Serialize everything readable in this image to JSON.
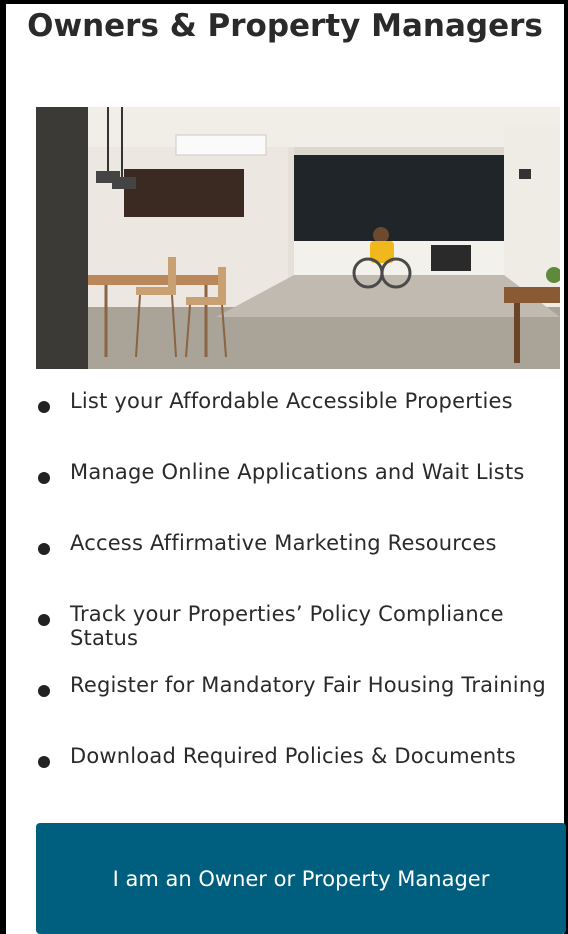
{
  "section": {
    "title": "Owners & Property Managers",
    "hero_image": "accessible-kitchen-photo"
  },
  "features": [
    {
      "label": "List your Affordable Accessible Properties"
    },
    {
      "label": "Manage Online Applications and Wait Lists"
    },
    {
      "label": "Access Affirmative Marketing Resources"
    },
    {
      "label": "Track your Properties’ Policy Compliance Status"
    },
    {
      "label": "Register for Mandatory Fair Housing Training"
    },
    {
      "label": "Download Required Policies & Documents"
    }
  ],
  "cta": {
    "label": "I am an Owner or Property Manager"
  },
  "colors": {
    "button_bg": "#005f7e",
    "button_text": "#ffffff",
    "heading_text": "#2a2a2a"
  }
}
